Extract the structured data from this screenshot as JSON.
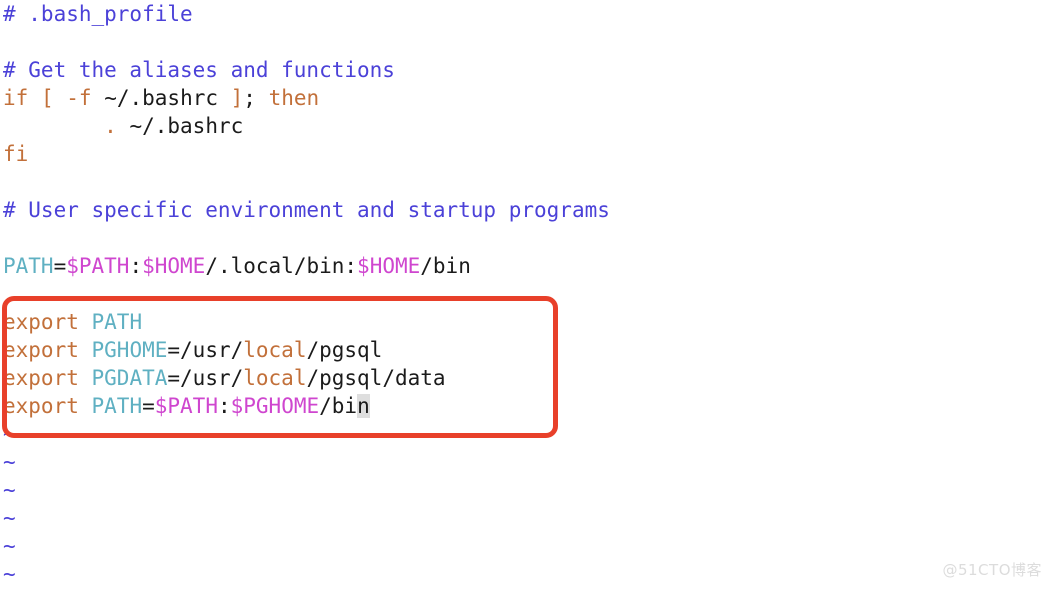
{
  "window": {
    "editor": "vim",
    "file_title": "# .bash_profile",
    "background_color": "#ffffff"
  },
  "colors": {
    "comment": "#4b41d8",
    "keyword": "#c2703a",
    "plain_text": "#1b1b1b",
    "variable_name": "#5fb0c2",
    "variable_expansion": "#cf46cf",
    "annotation_box": "#e8402a",
    "cursor_block": "#dedede",
    "tilde_filler": "#4b41d8",
    "watermark": "#dcdcdc"
  },
  "code_lines": [
    {
      "index": 0,
      "text": "# .bash_profile",
      "tokens": [
        {
          "t": "# .bash_profile",
          "c": "comment"
        }
      ]
    },
    {
      "index": 1,
      "text": "",
      "tokens": []
    },
    {
      "index": 2,
      "text": "# Get the aliases and functions",
      "tokens": [
        {
          "t": "# Get the aliases and functions",
          "c": "comment"
        }
      ]
    },
    {
      "index": 3,
      "text": "if [ -f ~/.bashrc ]; then",
      "tokens": [
        {
          "t": "if",
          "c": "keyword"
        },
        {
          "t": " ",
          "c": "plain"
        },
        {
          "t": "[",
          "c": "keyword"
        },
        {
          "t": " ",
          "c": "plain"
        },
        {
          "t": "-f",
          "c": "keyword"
        },
        {
          "t": " ~/.bashrc ",
          "c": "plain"
        },
        {
          "t": "]",
          "c": "keyword"
        },
        {
          "t": "; ",
          "c": "plain"
        },
        {
          "t": "then",
          "c": "keyword"
        }
      ]
    },
    {
      "index": 4,
      "text": "        . ~/.bashrc",
      "tokens": [
        {
          "t": "        ",
          "c": "plain"
        },
        {
          "t": ".",
          "c": "keyword"
        },
        {
          "t": " ~/.bashrc",
          "c": "plain"
        }
      ]
    },
    {
      "index": 5,
      "text": "fi",
      "tokens": [
        {
          "t": "fi",
          "c": "keyword"
        }
      ]
    },
    {
      "index": 6,
      "text": "",
      "tokens": []
    },
    {
      "index": 7,
      "text": "# User specific environment and startup programs",
      "tokens": [
        {
          "t": "# User specific environment and startup programs",
          "c": "comment"
        }
      ]
    },
    {
      "index": 8,
      "text": "",
      "tokens": []
    },
    {
      "index": 9,
      "text": "PATH=$PATH:$HOME/.local/bin:$HOME/bin",
      "tokens": [
        {
          "t": "PATH",
          "c": "var"
        },
        {
          "t": "=",
          "c": "plain"
        },
        {
          "t": "$PATH",
          "c": "dollar"
        },
        {
          "t": ":",
          "c": "plain"
        },
        {
          "t": "$HOME",
          "c": "dollar"
        },
        {
          "t": "/.local/bin:",
          "c": "plain"
        },
        {
          "t": "$HOME",
          "c": "dollar"
        },
        {
          "t": "/bin",
          "c": "plain"
        }
      ]
    },
    {
      "index": 10,
      "text": "",
      "tokens": []
    },
    {
      "index": 11,
      "text": "export PATH",
      "highlighted": true,
      "tokens": [
        {
          "t": "export",
          "c": "keyword"
        },
        {
          "t": " ",
          "c": "plain"
        },
        {
          "t": "PATH",
          "c": "var"
        }
      ]
    },
    {
      "index": 12,
      "text": "export PGHOME=/usr/local/pgsql",
      "highlighted": true,
      "tokens": [
        {
          "t": "export",
          "c": "keyword"
        },
        {
          "t": " ",
          "c": "plain"
        },
        {
          "t": "PGHOME",
          "c": "var"
        },
        {
          "t": "=",
          "c": "plain"
        },
        {
          "t": "/usr/",
          "c": "plain"
        },
        {
          "t": "local",
          "c": "keyword"
        },
        {
          "t": "/pgsql",
          "c": "plain"
        }
      ]
    },
    {
      "index": 13,
      "text": "export PGDATA=/usr/local/pgsql/data",
      "highlighted": true,
      "tokens": [
        {
          "t": "export",
          "c": "keyword"
        },
        {
          "t": " ",
          "c": "plain"
        },
        {
          "t": "PGDATA",
          "c": "var"
        },
        {
          "t": "=",
          "c": "plain"
        },
        {
          "t": "/usr/",
          "c": "plain"
        },
        {
          "t": "local",
          "c": "keyword"
        },
        {
          "t": "/pgsql/data",
          "c": "plain"
        }
      ]
    },
    {
      "index": 14,
      "text": "export PATH=$PATH:$PGHOME/bin",
      "highlighted": true,
      "cursor_char": "n",
      "tokens": [
        {
          "t": "export",
          "c": "keyword"
        },
        {
          "t": " ",
          "c": "plain"
        },
        {
          "t": "PATH",
          "c": "var"
        },
        {
          "t": "=",
          "c": "plain"
        },
        {
          "t": "$PATH",
          "c": "dollar"
        },
        {
          "t": ":",
          "c": "plain"
        },
        {
          "t": "$PGHOME",
          "c": "dollar"
        },
        {
          "t": "/bi",
          "c": "plain"
        },
        {
          "t": "n",
          "c": "cursor"
        }
      ]
    }
  ],
  "tilde_lines": [
    "~",
    "~",
    "~",
    "~",
    "~",
    "~"
  ],
  "annotation": {
    "label": "red-highlight-rectangle",
    "surrounds_lines": [
      "export PATH",
      "export PGHOME=/usr/local/pgsql",
      "export PGDATA=/usr/local/pgsql/data",
      "export PATH=$PATH:$PGHOME/bin"
    ]
  },
  "watermark": {
    "text": "@51CTO博客"
  }
}
